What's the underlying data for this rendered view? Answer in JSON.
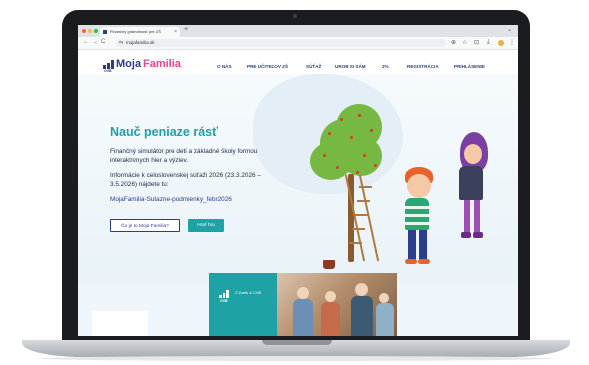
{
  "browser": {
    "tab_title": "Finančný gramotnosť pre ZŠ",
    "tab_close": "×",
    "new_tab": "+",
    "url": "mojafamilia.sk",
    "nav_icons": {
      "back": "arrow-left-icon",
      "forward": "arrow-right-icon",
      "reload": "reload-icon",
      "info": "site-info-icon"
    },
    "toolbar_icons": {
      "zoom": "zoom-icon",
      "bookmark": "star-icon",
      "extensions": "puzzle-icon",
      "download": "download-icon",
      "profile": "avatar-icon",
      "menu": "kebab-menu-icon"
    },
    "dot_colors": [
      "#ff5f57",
      "#febc2e",
      "#28c840"
    ],
    "glyphs": {
      "back": "←",
      "forward": "→",
      "reload": "C",
      "info": "⇆",
      "zoom": "⊕",
      "star": "☆",
      "ext": "⊡",
      "download": "⤓",
      "menu": "⋮",
      "dropdown": "⌄"
    }
  },
  "site": {
    "logo": {
      "moja": "Moja",
      "familia": "Familia",
      "ovb": "OVB"
    },
    "nav": [
      "O NÁS",
      "PRE UČITEĽOV ZŠ",
      "SÚŤAŽ",
      "UROB SI SÁM",
      "2%",
      "REGISTRÁCIA",
      "PRIHLÁSENIE"
    ]
  },
  "hero": {
    "title": "Nauč peniaze rásť",
    "line1": "Finančný simulátor pre deti a základné školy formou",
    "line2": "interaktívnych hier a výziev.",
    "line3": "Informácie k celoslovenskej súťaži 2026 (23.3.2026 –",
    "line4": "3.5.2026) nájdete tu:",
    "link": "MojaFamilia-Sutazne-podmienky_febr2026",
    "button_secondary": "Čo je to Moja Familia?",
    "button_primary": "Hrať hru"
  },
  "banner": {
    "ovb": "OVB",
    "text": "Z Darts & CVB"
  },
  "colors": {
    "brand_blue": "#2b3e8c",
    "brand_teal": "#1fa2a6",
    "brand_pink": "#e6458a"
  }
}
